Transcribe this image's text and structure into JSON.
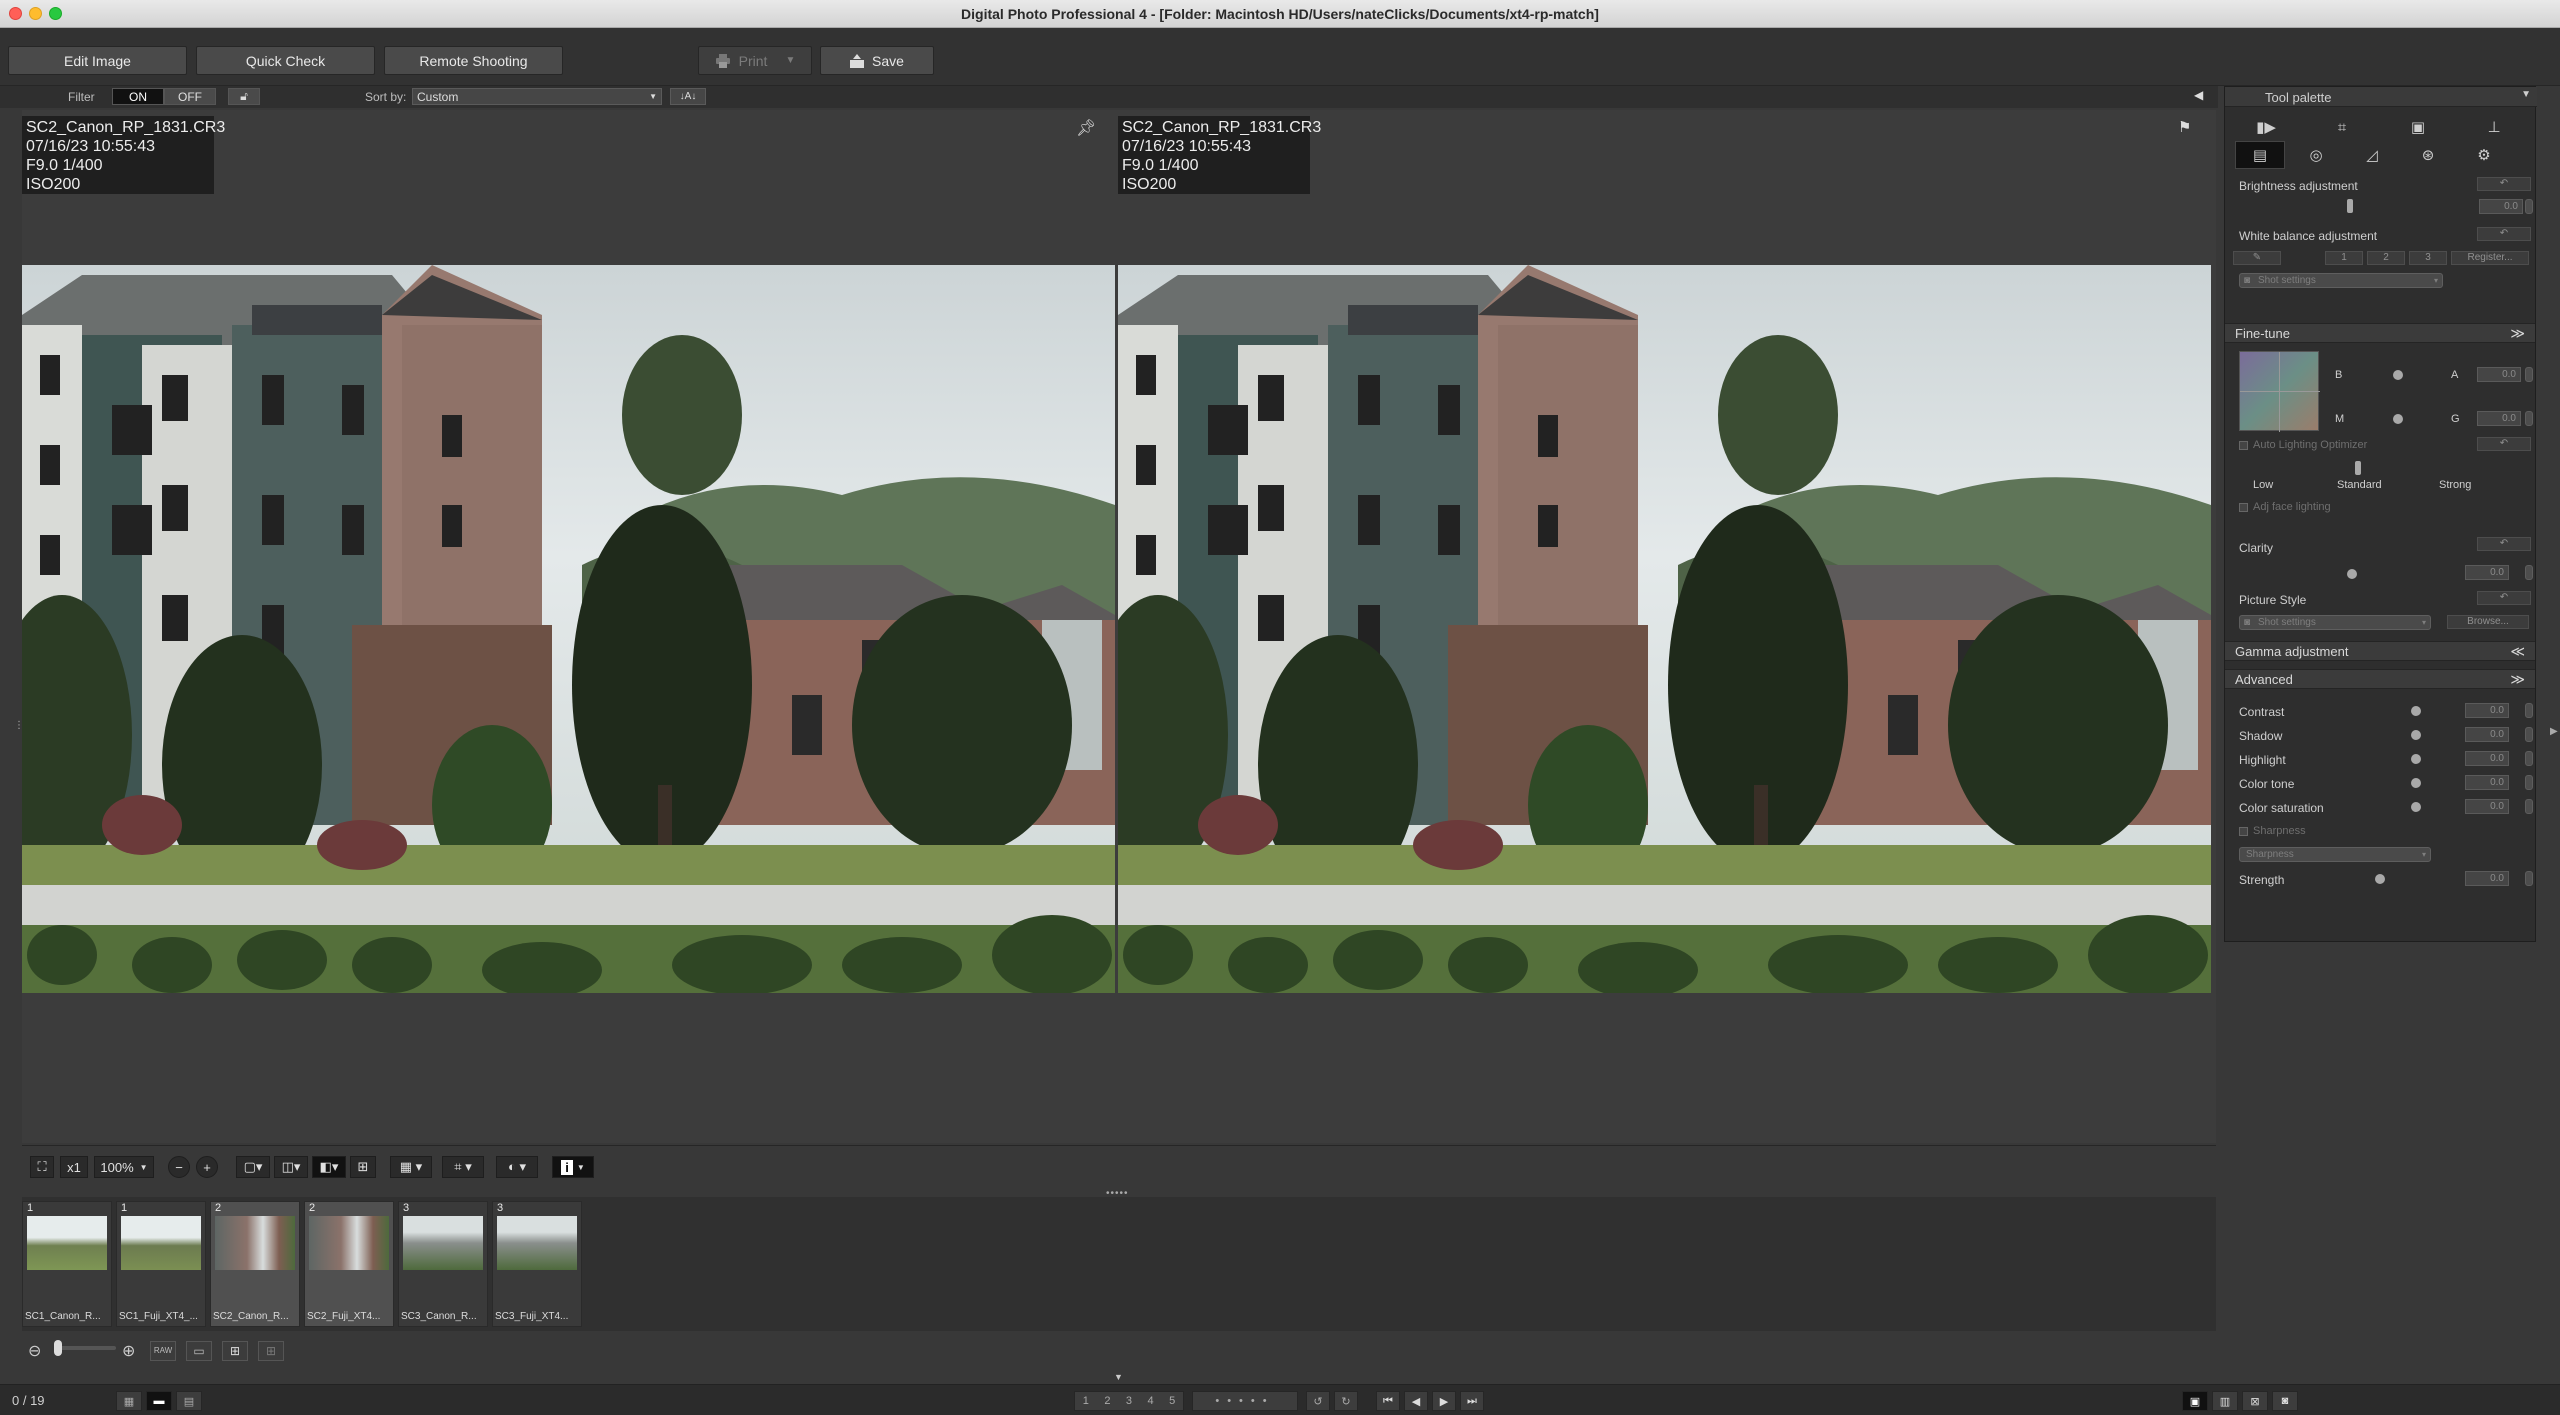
{
  "window": {
    "title": "Digital Photo Professional 4 - [Folder: Macintosh HD/Users/nateClicks/Documents/xt4-rp-match]"
  },
  "toolbar": {
    "edit_image": "Edit Image",
    "quick_check": "Quick Check",
    "remote_shooting": "Remote Shooting",
    "print": "Print",
    "save": "Save"
  },
  "filterbar": {
    "filter_label": "Filter",
    "on": "ON",
    "off": "OFF",
    "sort_label": "Sort by:",
    "sort_value": "Custom"
  },
  "viewer": {
    "left": {
      "filename": "SC2_Canon_RP_1831.CR3",
      "datetime": "07/16/23 10:55:43",
      "exposure": "F9.0 1/400",
      "iso": "ISO200"
    },
    "right": {
      "filename": "SC2_Canon_RP_1831.CR3",
      "datetime": "07/16/23 10:55:43",
      "exposure": "F9.0 1/400",
      "iso": "ISO200"
    }
  },
  "viewtoolbar": {
    "magnify": "x1",
    "zoom": "100%"
  },
  "filmstrip": {
    "thumbs": [
      {
        "num": "1",
        "label": "SC1_Canon_R..."
      },
      {
        "num": "1",
        "label": "SC1_Fuji_XT4_..."
      },
      {
        "num": "2",
        "label": "SC2_Canon_R..."
      },
      {
        "num": "2",
        "label": "SC2_Fuji_XT4..."
      },
      {
        "num": "3",
        "label": "SC3_Canon_R..."
      },
      {
        "num": "3",
        "label": "SC3_Fuji_XT4..."
      }
    ]
  },
  "status": {
    "count": "0 / 19",
    "ratings": [
      "1",
      "2",
      "3",
      "4",
      "5"
    ]
  },
  "palette": {
    "title": "Tool palette",
    "brightness": "Brightness adjustment",
    "white_balance": "White balance adjustment",
    "wb_presets": [
      "1",
      "2",
      "3"
    ],
    "register": "Register...",
    "shot_settings": "Shot settings",
    "fine_tune": "Fine-tune",
    "fine_tune_labels": [
      "B",
      "A",
      "M",
      "G"
    ],
    "alo": "Auto Lighting Optimizer",
    "alo_levels": [
      "Low",
      "Standard",
      "Strong"
    ],
    "adj_face": "Adj face lighting",
    "clarity": "Clarity",
    "picture_style": "Picture Style",
    "picture_style_value": "Shot settings",
    "browse": "Browse...",
    "gamma": "Gamma adjustment",
    "advanced": "Advanced",
    "advanced_items": [
      "Contrast",
      "Shadow",
      "Highlight",
      "Color tone",
      "Color saturation"
    ],
    "sharpness": "Sharpness",
    "sharpness_select": "Sharpness",
    "strength": "Strength",
    "value": "0.0"
  },
  "colors": {
    "accent": "#3a6ea5",
    "panel": "#2e2e2e",
    "background": "#383838"
  }
}
